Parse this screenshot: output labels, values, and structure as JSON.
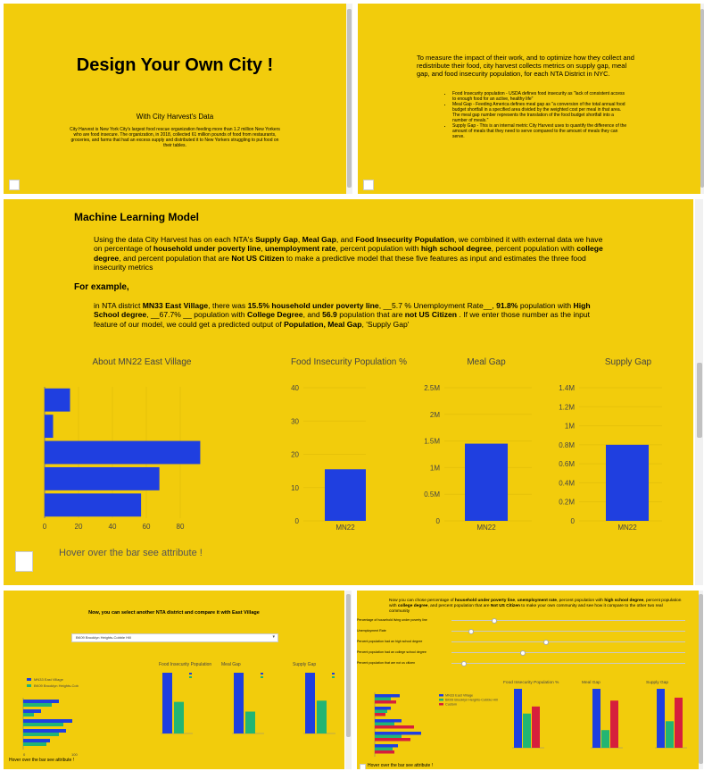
{
  "slide1": {
    "title": "Design Your Own City !",
    "subtitle": "With City Harvest's Data",
    "body": "City Harvest is New York City's largest food rescue organization feeding more than 1.2 million New Yorkers who are food insecure. The organization, in 2018, collected 61 million pounds of food from restaurants, groceries, and farms that had an excess supply and distributed it to New Yorkers struggling to put food on their tables."
  },
  "slide2": {
    "intro": "To measure the impact of their work, and to optimize how they collect and redistribute their food, city harvest collects metrics on supply gap, meal gap, and food insecurity population, for each NTA District in NYC.",
    "bullets": [
      "Food Insecurity population - USDA defines food insecurity as \"lack of consistent access to enough food for an active, healthy life\"",
      "Meal Gap - Feeding America defines meal gap as \"a conversion of the total annual food budget shortfall in a specified area divided by the weighted cost per meal in that area. The meal gap number represents the translation of the food budget shortfall into a number of meals.\"",
      "Supply Gap - This is an internal metric City Harvest uses to quantify the difference of the amount of meals that they need to serve compared to the amount of meals they can serve."
    ]
  },
  "slide3": {
    "heading": "Machine Learning Model",
    "para1_parts": [
      "Using the data City Harvest has on each NTA's ",
      "Supply Gap",
      ", ",
      "Meal Gap",
      ", and ",
      "Food Insecurity Population",
      ", we combined it with external data we have on percentage of ",
      "household under poverty line",
      ", ",
      "unemployment rate",
      ", percent population with ",
      "high school degree",
      ", percent population with ",
      "college degree",
      ", and percent population that are ",
      "Not US Citizen",
      " to make a predictive model that these five features as input and estimates the three food insecurity metrics"
    ],
    "example_heading": "For example,",
    "para2_parts": [
      "in NTA district ",
      "MN33 East Village",
      ", there was ",
      "15.5% household under poverty line",
      ", __5.7 % Unemployment Rate__, ",
      "91.8%",
      " population with ",
      "High School degree",
      ", __67.7% __ population with ",
      "College Degree",
      ", and ",
      "56.9",
      " population that are ",
      "not US Citizen",
      " . If we enter those number as the input feature of our model, we could get a predicted output of ",
      "Population, Meal Gap",
      ", 'Supply Gap'"
    ],
    "hover_note": "Hover over the bar see attribute !"
  },
  "slide4": {
    "instruction": "Now, you can select another NTA district and compare it with East Village",
    "dropdown_value": "BK09 Brooklyn Heights-Cobble Hill",
    "legend": [
      "MN33 East Village",
      "BK09 Brooklyn Heights-Cob"
    ],
    "chart_titles": [
      "Food Insecurity Population",
      "Meal Gap",
      "Supply Gap"
    ],
    "hover_note": "Hover over the bar see attribute !"
  },
  "slide5": {
    "instruction_parts": [
      "Now you can chose percentage of ",
      "household under poverty line",
      ", ",
      "unemployment rate",
      ", percent population with ",
      "high school degree",
      ", percent population with ",
      "college degree",
      ", and percent population that are ",
      "Not US Citizen",
      " to make your own community and see how it compare to the other two real community"
    ],
    "slider_labels": [
      "Percentage of household living under poverty line",
      "Unemployment Rate",
      "Percent population had an high school degree",
      "Percent population had an college school degree",
      "Percent population that are not us citizen"
    ],
    "legend": [
      "MN33 East Village",
      "BK09 Brooklyn Heights-Cobble Hill",
      "Custom"
    ],
    "chart_titles": [
      "Food Insecurity Population %",
      "Meal Gap",
      "Supply Gap"
    ],
    "hover_note": "Hover over the bar see attribute !"
  },
  "colors": {
    "panel_bg": "#f2cc0c",
    "blue": "#1f3fe0",
    "green": "#22b573",
    "red": "#d61f3c"
  },
  "chart_data": [
    {
      "type": "bar",
      "title": "About MN22 East Village",
      "orientation": "horizontal",
      "values": [
        15,
        5,
        91.8,
        67.7,
        56.9
      ],
      "xlim": [
        0,
        100
      ],
      "xticks": [
        0,
        20,
        40,
        60,
        80
      ]
    },
    {
      "type": "bar",
      "title": "Food Insecurity Population %",
      "categories": [
        "MN22"
      ],
      "values": [
        15.5
      ],
      "ylim": [
        0,
        40
      ],
      "yticks": [
        0,
        10,
        20,
        30,
        40
      ]
    },
    {
      "type": "bar",
      "title": "Meal Gap",
      "categories": [
        "MN22"
      ],
      "values": [
        1450000
      ],
      "ylim": [
        0,
        2500000
      ],
      "yticks": [
        "0",
        "0.5M",
        "1M",
        "1.5M",
        "2M",
        "2.5M"
      ]
    },
    {
      "type": "bar",
      "title": "Supply Gap",
      "categories": [
        "MN22"
      ],
      "values": [
        800000
      ],
      "ylim": [
        0,
        1400000
      ],
      "yticks": [
        "0",
        "0.2M",
        "0.4M",
        "0.6M",
        "0.8M",
        "1M",
        "1.2M",
        "1.4M"
      ]
    }
  ]
}
